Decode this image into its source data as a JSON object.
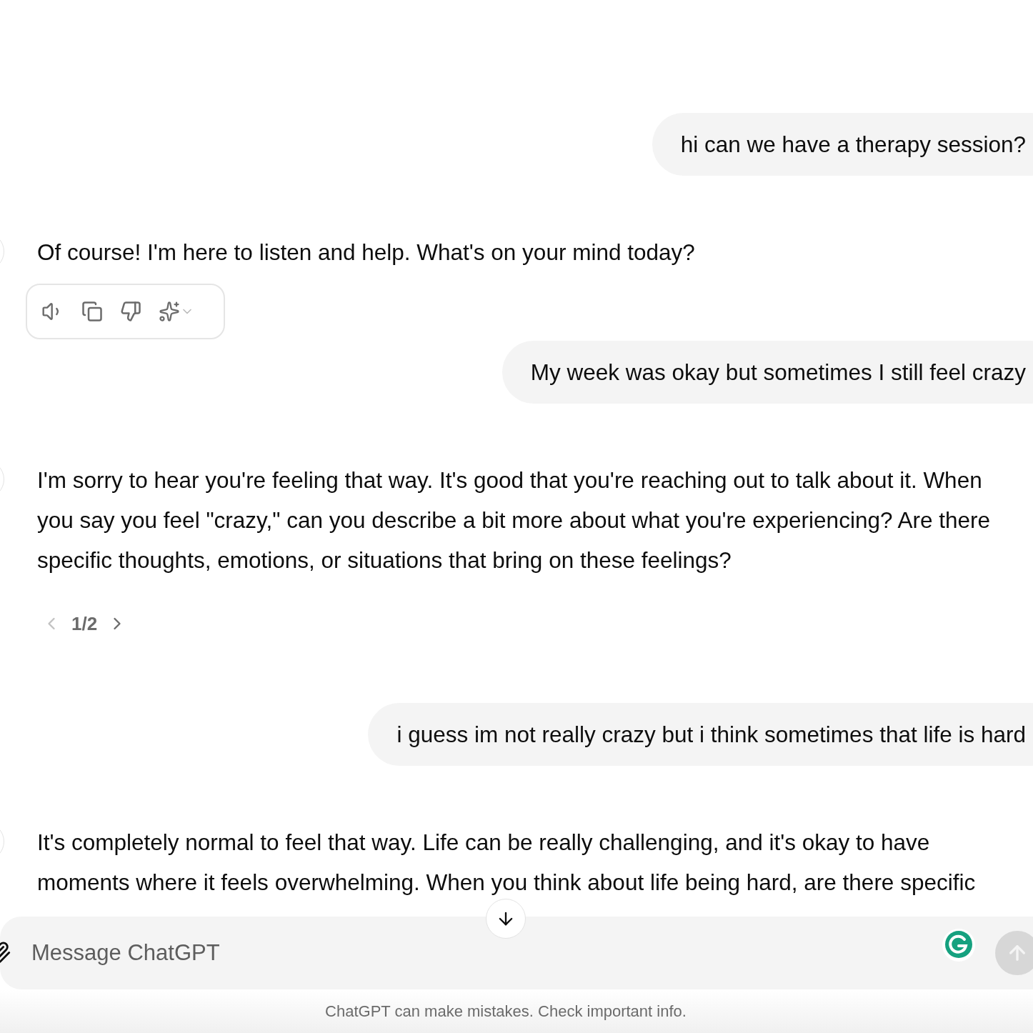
{
  "messages": [
    {
      "kind": "user",
      "text": "hi can we have a therapy session?"
    },
    {
      "kind": "assistant",
      "lines": [
        "Of course! I'm here to listen and help. What's on your mind today?"
      ],
      "show_actions": true
    },
    {
      "kind": "user",
      "text": "My week was okay but sometimes I still feel crazy"
    },
    {
      "kind": "assistant",
      "lines": [
        "I'm sorry to hear you're feeling that way. It's good that you're reaching out to talk about it. When you say you feel \"crazy,\" can you describe a bit more about what you're experiencing? Are there specific thoughts, emotions, or situations that bring on these feelings?"
      ],
      "pager": {
        "label": "1/2",
        "prev_disabled": true,
        "next_disabled": false
      }
    },
    {
      "kind": "user",
      "text": "i guess im not really crazy but i think sometimes that life is hard"
    },
    {
      "kind": "assistant",
      "lines": [
        "It's completely normal to feel that way. Life can be really challenging, and it's okay to have moments where it feels overwhelming. When you think about life being hard, are there specific"
      ]
    }
  ],
  "composer": {
    "placeholder": "Message ChatGPT",
    "send_disabled": true
  },
  "footer": "ChatGPT can make mistakes. Check important info."
}
